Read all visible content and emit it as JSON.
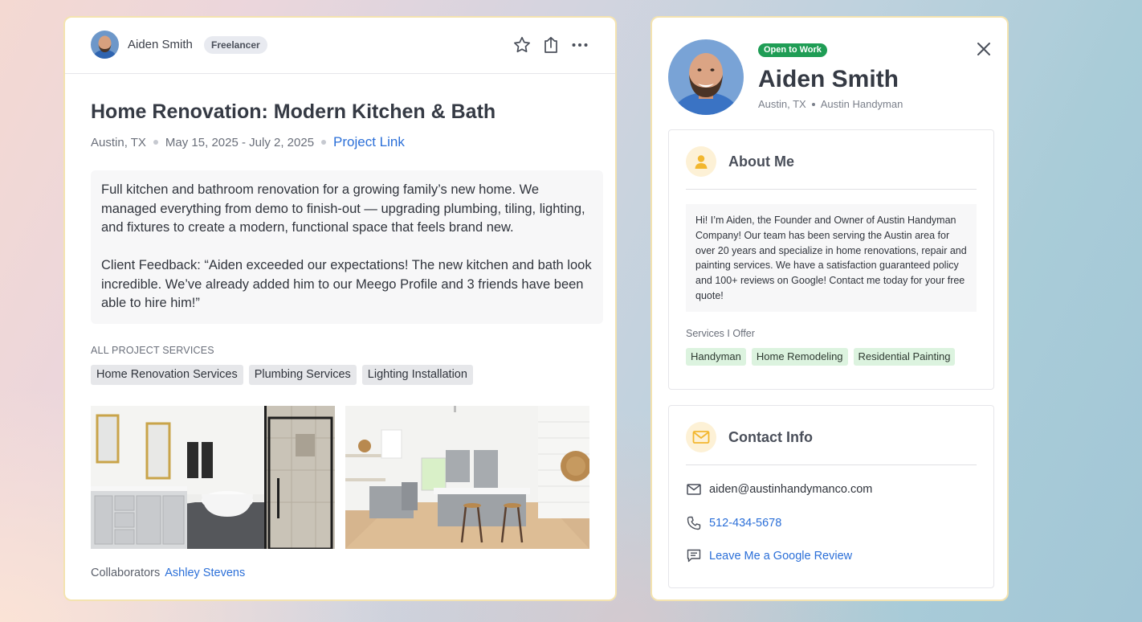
{
  "project": {
    "author_name": "Aiden Smith",
    "author_role": "Freelancer",
    "header_icons": [
      "star-icon",
      "share-icon",
      "more-icon"
    ],
    "title": "Home Renovation: Modern Kitchen & Bath",
    "location": "Austin, TX",
    "dates": "May 15, 2025 - July 2, 2025",
    "project_link_label": "Project Link",
    "description_p1": "Full kitchen and bathroom renovation for a growing family’s new home. We managed everything from demo to finish-out — upgrading plumbing, tiling, lighting, and fixtures to create a modern, functional space that feels brand new.",
    "description_p2": "Client Feedback: “Aiden exceeded our expectations! The new kitchen and bath look incredible. We’ve already added him to our Meego Profile and 3 friends have been able to hire him!”",
    "services_heading": "ALL PROJECT SERVICES",
    "services": [
      "Home Renovation Services",
      "Plumbing Services",
      "Lighting Installation"
    ],
    "collaborators_label": "Collaborators",
    "collaborator_name": "Ashley Stevens"
  },
  "profile": {
    "status_badge": "Open to Work",
    "name": "Aiden Smith",
    "location": "Austin, TX",
    "company": "Austin Handyman",
    "about_title": "About Me",
    "about_text": "Hi! I’m Aiden, the Founder and Owner of Austin Handyman Company! Our team has been serving the Austin area for over 20 years and specialize in home renovations, repair and painting services. We have a satisfaction guaranteed policy and 100+ reviews on Google! Contact me today for your free quote!",
    "services_label": "Services I Offer",
    "services": [
      "Handyman",
      "Home Remodeling",
      "Residential Painting"
    ],
    "contact_title": "Contact Info",
    "email": "aiden@austinhandymanco.com",
    "phone": "512-434-5678",
    "review_link": "Leave Me a Google Review"
  },
  "colors": {
    "accent_link": "#2b6fd8",
    "open_badge": "#1f9d55",
    "card_border": "#f4e3b0",
    "service_tag_green": "#dcf3df",
    "section_icon_bg": "#fdf1d6"
  }
}
